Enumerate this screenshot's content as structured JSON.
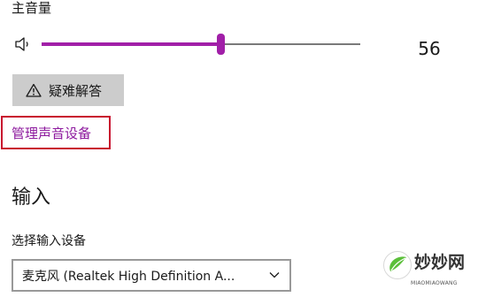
{
  "output": {
    "volume_label": "主音量",
    "volume_value": "56",
    "volume_level_percent": 56,
    "troubleshoot_label": "疑难解答",
    "manage_devices_link": "管理声音设备"
  },
  "input": {
    "heading": "输入",
    "select_device_label": "选择输入设备",
    "selected_device": "麦克风 (Realtek High Definition A..."
  },
  "watermark": {
    "name": "妙妙网",
    "subtitle": "MIAOMIAOWANG"
  },
  "colors": {
    "accent": "#a11fa8",
    "link": "#8d1a9e",
    "highlight_box": "#c8102e",
    "button_bg": "#cccccc"
  },
  "icons": {
    "speaker": "speaker-icon",
    "warning": "warning-icon",
    "dropdown": "chevron-down-icon"
  }
}
